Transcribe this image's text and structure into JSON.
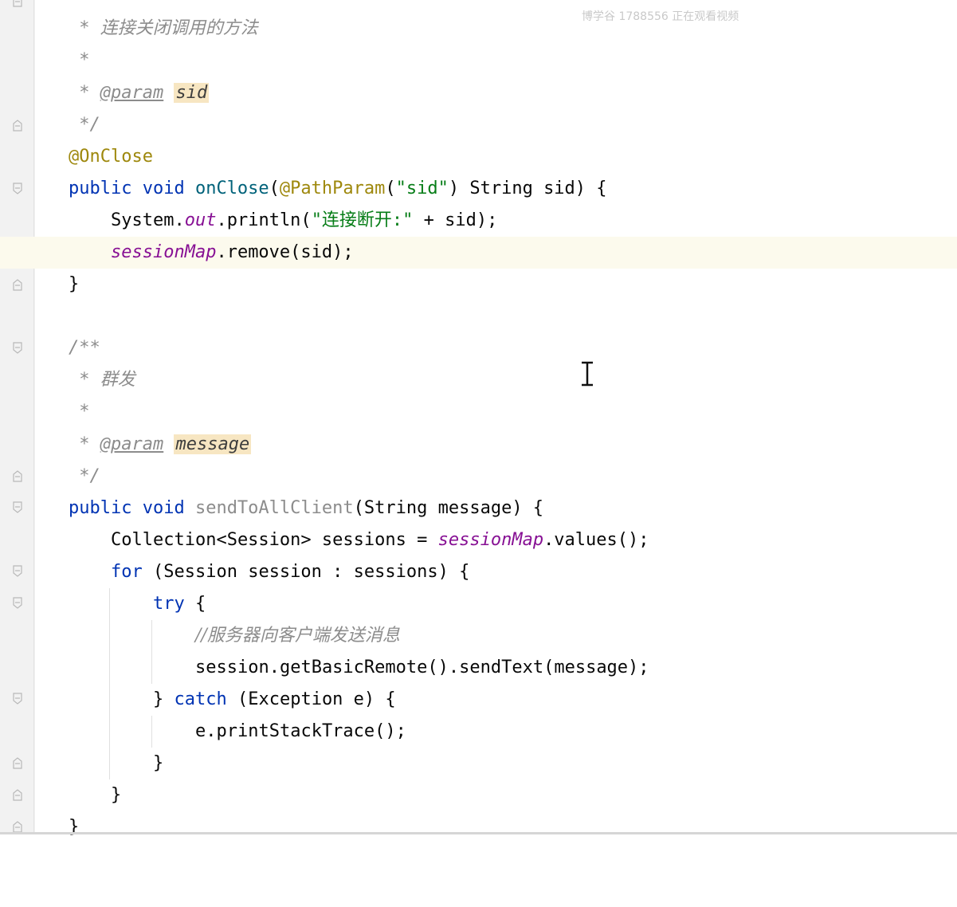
{
  "watermark": "博学谷 1788556 正在观看视频",
  "lines": {
    "l1": {
      "star": " * ",
      "text": "连接关闭调用的方法"
    },
    "l2": {
      "star": " *"
    },
    "l3": {
      "star": " * ",
      "tag": "@param",
      "param": "sid"
    },
    "l4": {
      "end": " */"
    },
    "l5": {
      "annotation": "@OnClose"
    },
    "l6": {
      "kw": "public void ",
      "method": "onClose",
      "p1": "(",
      "annot": "@PathParam",
      "p2": "(",
      "str": "\"sid\"",
      "rest": ") String sid) {"
    },
    "l7": {
      "pre": "System.",
      "static": "out",
      "mid": ".println(",
      "str": "\"连接断开:\"",
      "rest": " + sid);"
    },
    "l8": {
      "static": "sessionMap",
      "rest": ".remove(sid);"
    },
    "l9": {
      "text": "}"
    },
    "l11": {
      "text": "/**"
    },
    "l12": {
      "star": " * ",
      "text": "群发"
    },
    "l13": {
      "star": " *"
    },
    "l14": {
      "star": " * ",
      "tag": "@param",
      "param": "message"
    },
    "l15": {
      "end": " */"
    },
    "l16": {
      "kw": "public void ",
      "method": "sendToAllClient",
      "rest": "(String message) {"
    },
    "l17": {
      "pre": "Collection<Session> sessions = ",
      "static": "sessionMap",
      "rest": ".values();"
    },
    "l18": {
      "kw": "for",
      "rest": " (Session session : sessions) {"
    },
    "l19": {
      "kw": "try",
      "rest": " {"
    },
    "l20": {
      "text": "//服务器向客户端发送消息"
    },
    "l21": {
      "text": "session.getBasicRemote().sendText(message);"
    },
    "l22": {
      "pre": "} ",
      "kw": "catch",
      "rest": " (Exception e) {"
    },
    "l23": {
      "text": "e.printStackTrace();"
    },
    "l24": {
      "text": "}"
    },
    "l25": {
      "text": "}"
    },
    "l26": {
      "text": "}"
    }
  },
  "colors": {
    "keyword": "#0033b3",
    "annotation": "#9e880d",
    "string": "#067d17",
    "static_field": "#871094",
    "comment": "#8c8c8c",
    "current_line": "#fcfaed",
    "param_highlight": "#f7e6c2"
  },
  "icons": {
    "gutter_intention": "lightbulb-icon",
    "fold_markers": "fold-marker-icon",
    "mouse_cursor": "text-cursor-icon"
  }
}
